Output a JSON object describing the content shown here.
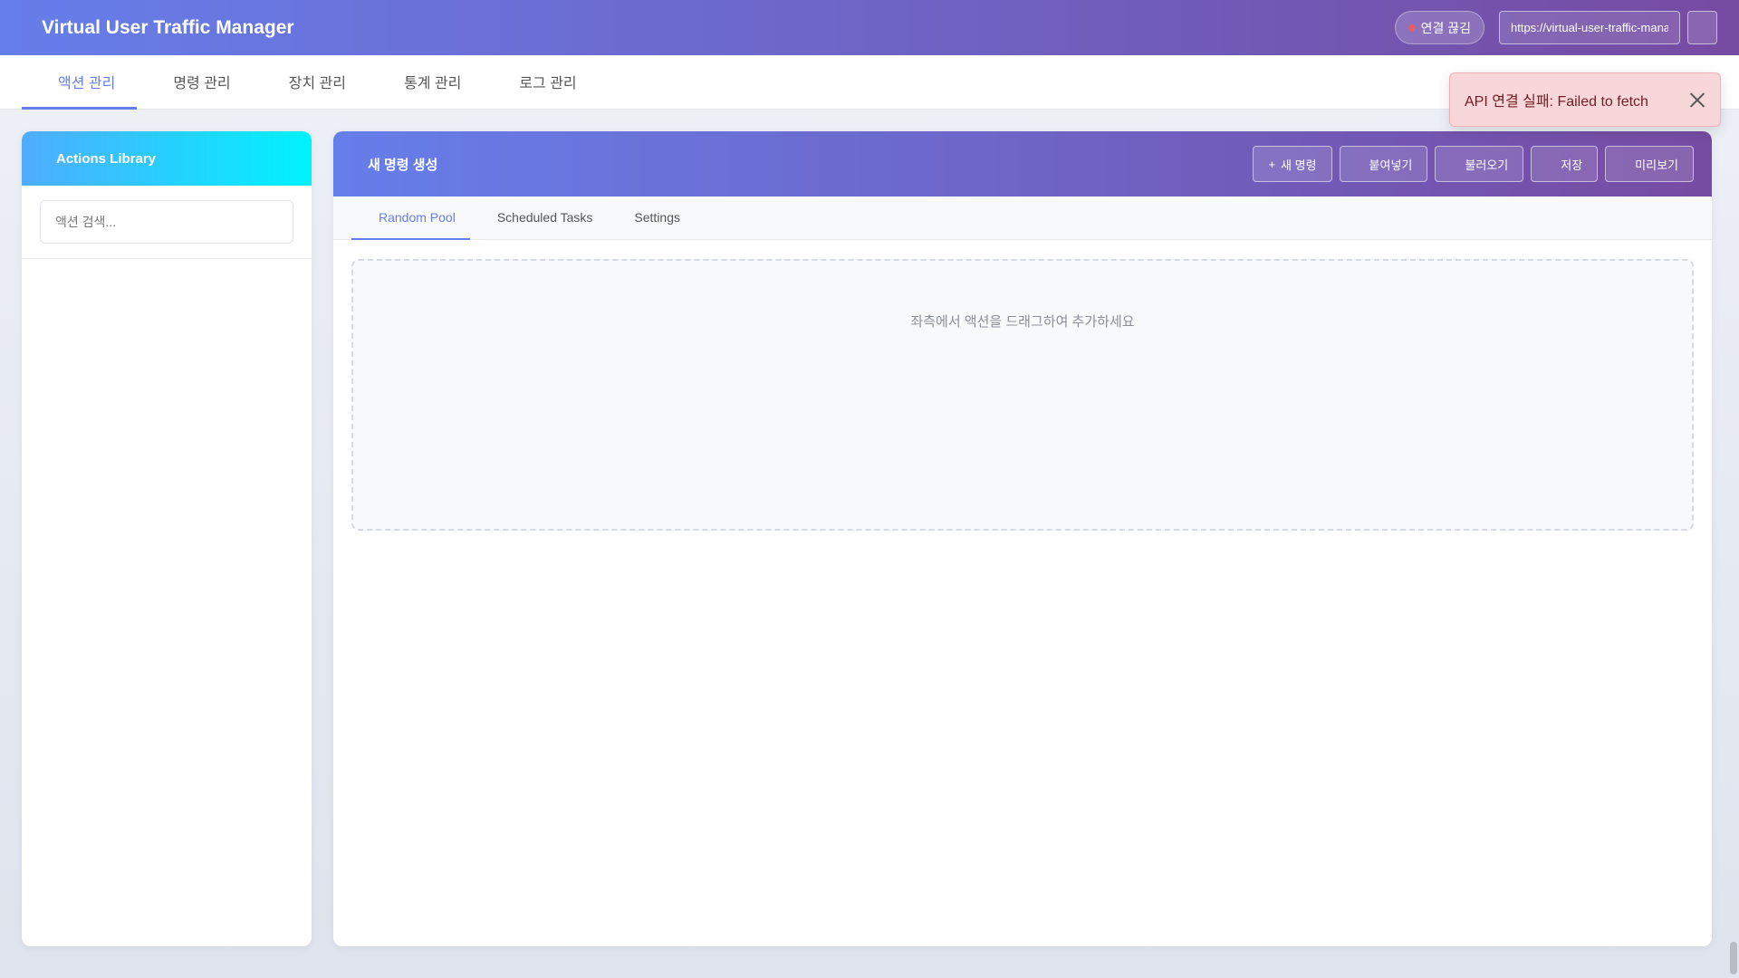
{
  "header": {
    "glyph": "",
    "title": "Virtual User Traffic Manager",
    "status_label": "연결 끊김",
    "status_color": "#e35d6a",
    "url_value": "https://virtual-user-traffic-manager",
    "settings_glyph": ""
  },
  "nav": {
    "tabs": [
      {
        "glyph": "",
        "label": "액션 관리",
        "active": true
      },
      {
        "glyph": "",
        "label": "명령 관리",
        "active": false
      },
      {
        "glyph": "",
        "label": "장치 관리",
        "active": false
      },
      {
        "glyph": "",
        "label": "통계 관리",
        "active": false
      },
      {
        "glyph": "",
        "label": "로그 관리",
        "active": false
      }
    ]
  },
  "sidebar": {
    "glyph": "",
    "title": "Actions Library",
    "search_placeholder": "액션 검색..."
  },
  "editor": {
    "glyph": "",
    "title": "새 명령 생성",
    "toolbar": [
      {
        "glyph": "+",
        "label": "새 명령"
      },
      {
        "glyph": "",
        "label": "붙여넣기"
      },
      {
        "glyph": "",
        "label": "불러오기"
      },
      {
        "glyph": "",
        "label": "저장"
      },
      {
        "glyph": "",
        "label": "미리보기"
      }
    ],
    "tabs": [
      {
        "glyph": "",
        "label": "Random Pool",
        "active": true
      },
      {
        "glyph": "",
        "label": "Scheduled Tasks",
        "active": false
      },
      {
        "glyph": "",
        "label": "Settings",
        "active": false
      }
    ],
    "dropzone": {
      "glyph": "",
      "hint": "좌측에서 액션을 드래그하여 추가하세요"
    }
  },
  "toast": {
    "message": "API 연결 실패: Failed to fetch",
    "type": "error"
  },
  "colors": {
    "brand_start": "#667eea",
    "brand_end": "#764ba2",
    "sidebar_start": "#4facfe",
    "sidebar_end": "#00f2fe",
    "error_bg": "#f8d7da"
  }
}
